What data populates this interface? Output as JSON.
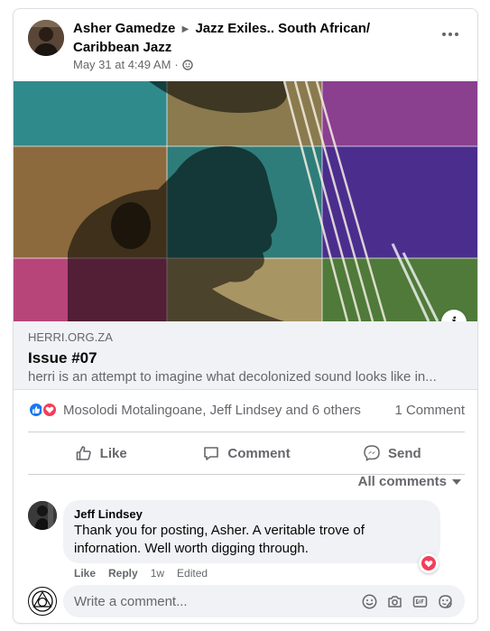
{
  "post": {
    "author": "Asher Gamedze",
    "group": "Jazz Exiles.. South African/ Caribbean Jazz",
    "timestamp": "May 31 at 4:49 AM",
    "separator": "·"
  },
  "link_preview": {
    "domain": "HERRI.ORG.ZA",
    "title": "Issue #07",
    "description": "herri is an attempt to imagine what decolonized sound looks like in..."
  },
  "engagement": {
    "reactors": "Mosolodi Motalingoane, Jeff Lindsey and 6 others",
    "comment_count": "1 Comment"
  },
  "actions": {
    "like": "Like",
    "comment": "Comment",
    "send": "Send"
  },
  "comments_filter": "All comments",
  "comment": {
    "author": "Jeff Lindsey",
    "text": "Thank you for posting, Asher. A veritable trove of infornation. Well worth digging through.",
    "like": "Like",
    "reply": "Reply",
    "age": "1w",
    "edited": "Edited"
  },
  "composer": {
    "placeholder": "Write a comment..."
  },
  "colors": {
    "accent": "#1877f2",
    "love": "#f33e58",
    "muted_text": "#65676b",
    "bubble": "#f0f2f5"
  }
}
